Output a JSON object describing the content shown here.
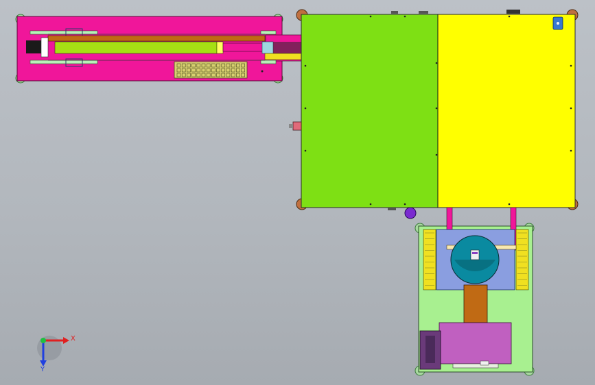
{
  "axis_triad": {
    "x_label": "X",
    "y_label": "Y",
    "x_color": "#e02020",
    "y_color": "#2040e0",
    "origin_color": "#20c040"
  },
  "colors": {
    "background": "#b4b9bf",
    "conveyor_frame": "#f0169a",
    "left_bed": "#7ee014",
    "right_bed": "#ffff00",
    "lower_platform": "#a8f090",
    "turntable_window": "#8a9ee0",
    "motor_block": "#c060c0",
    "column": "#c06a14",
    "purple_knob": "#7a2ad0",
    "caster": "#c07040"
  }
}
